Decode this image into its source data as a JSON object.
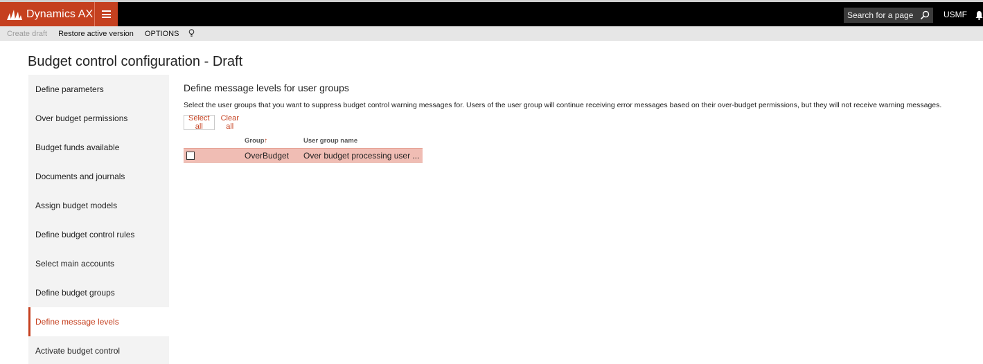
{
  "app": {
    "name": "Dynamics AX",
    "search_placeholder": "Search for a page",
    "company": "USMF"
  },
  "actions": {
    "create_draft": "Create draft",
    "restore_active_version": "Restore active version",
    "options": "OPTIONS"
  },
  "page": {
    "title": "Budget control configuration - Draft"
  },
  "nav": {
    "items": [
      {
        "label": "Define parameters"
      },
      {
        "label": "Over budget permissions"
      },
      {
        "label": "Budget funds available"
      },
      {
        "label": "Documents and journals"
      },
      {
        "label": "Assign budget models"
      },
      {
        "label": "Define budget control rules"
      },
      {
        "label": "Select main accounts"
      },
      {
        "label": "Define budget groups"
      },
      {
        "label": "Define message levels"
      },
      {
        "label": "Activate budget control"
      }
    ],
    "active_index": 8
  },
  "section": {
    "title": "Define message levels for user groups",
    "description": "Select the user groups that you want to suppress budget control warning messages for. Users of the user group will continue receiving error messages based on their over-budget permissions, but they will not receive warning messages.",
    "select_all": "Select all",
    "clear_all": "Clear all"
  },
  "grid": {
    "columns": {
      "group": "Group",
      "user_group_name": "User group name"
    },
    "rows": [
      {
        "group": "OverBudget",
        "user_group_name": "Over budget processing user ...",
        "checked": false
      }
    ]
  },
  "colors": {
    "accent": "#c5401f",
    "selected_row": "#f0bdb4",
    "topbar": "#000000",
    "actionbar": "#e6e6e6",
    "nav_background": "#f3f3f3"
  }
}
